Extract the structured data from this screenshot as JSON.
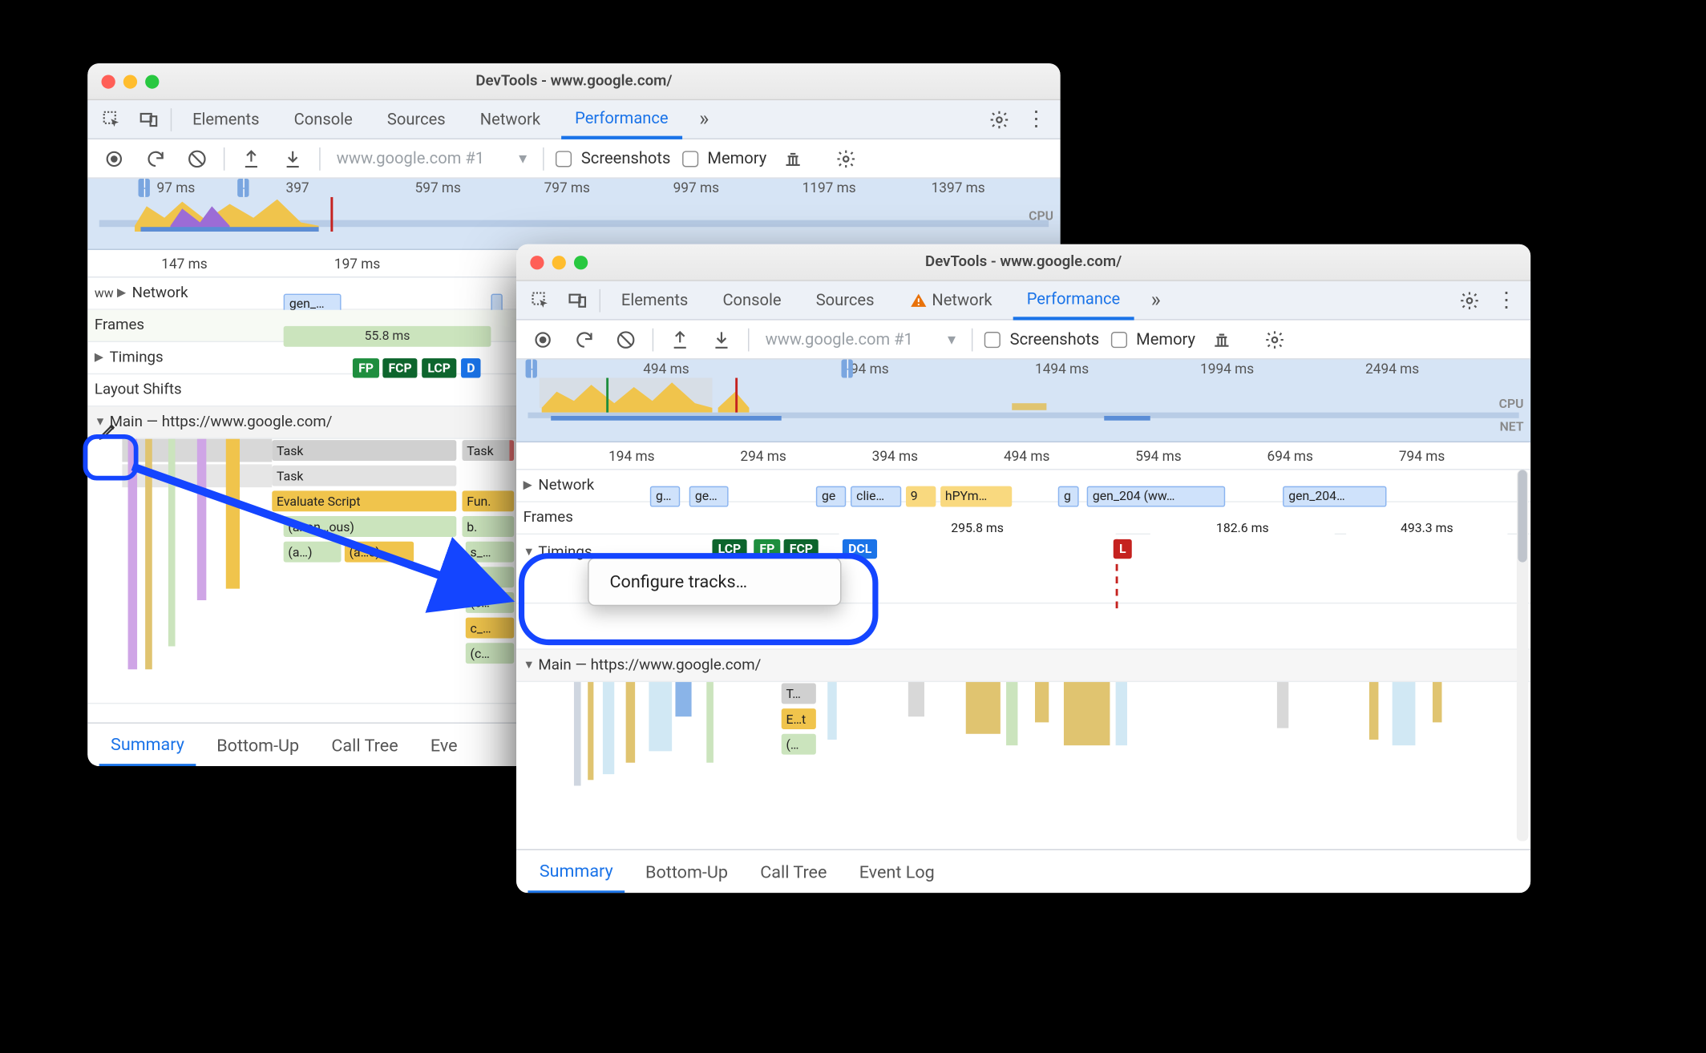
{
  "windowA": {
    "title": "DevTools - www.google.com/",
    "tabs": [
      "Elements",
      "Console",
      "Sources",
      "Network",
      "Performance"
    ],
    "activeTabIndex": 4,
    "dropdown": "www.google.com #1",
    "checkScreenshots": "Screenshots",
    "checkMemory": "Memory",
    "overviewTicks": [
      "97 ms",
      "397",
      "597 ms",
      "797 ms",
      "997 ms",
      "1197 ms",
      "1397 ms"
    ],
    "cpuLabel": "CPU",
    "ruler2": [
      "147 ms",
      "197 ms"
    ],
    "tracks": {
      "networkLabel": "Network",
      "networkPrefix": "ww",
      "networkChip": "gen_…",
      "framesLabel": "Frames",
      "framesValue": "55.8 ms",
      "timingsLabel": "Timings",
      "timingBadges": [
        "FP",
        "FCP",
        "LCP",
        "D"
      ],
      "layoutShiftsLabel": "Layout Shifts",
      "mainLabel": "Main — https://www.google.com/",
      "taskA": "Task",
      "taskB": "Task",
      "taskC": "Task",
      "evalScript": "Evaluate Script",
      "fun": "Fun.",
      "anon": "(anon…ous)",
      "b": "b.",
      "a1": "(a…)",
      "a2": "(a…s)",
      "s": "s_…",
      "dots": "._…",
      "c": "(c…",
      "cdot": "c_…",
      "cparen": "(c…"
    },
    "bottomTabs": [
      "Summary",
      "Bottom-Up",
      "Call Tree",
      "Eve"
    ],
    "activeBottomIndex": 0
  },
  "windowB": {
    "title": "DevTools - www.google.com/",
    "tabs": [
      "Elements",
      "Console",
      "Sources",
      "Network",
      "Performance"
    ],
    "networkWarning": true,
    "activeTabIndex": 4,
    "dropdown": "www.google.com #1",
    "checkScreenshots": "Screenshots",
    "checkMemory": "Memory",
    "overviewTicks": [
      "494 ms",
      "94 ms",
      "1494 ms",
      "1994 ms",
      "2494 ms"
    ],
    "cpuLabel": "CPU",
    "netLabel": "NET",
    "ruler2": [
      "194 ms",
      "294 ms",
      "394 ms",
      "494 ms",
      "594 ms",
      "694 ms",
      "794 ms"
    ],
    "tracks": {
      "networkLabel": "Network",
      "networkChips": [
        "g…",
        "ge…",
        "ge",
        "clie…",
        "9",
        "hPYm…",
        "g",
        "gen_204 (ww…",
        "gen_204…"
      ],
      "framesLabel": "Frames",
      "framesValues": [
        "295.8 ms",
        "182.6 ms",
        "493.3 ms"
      ],
      "timingsLabel": "Timings",
      "timingBadges": [
        "LCP",
        "FP",
        "FCP",
        "DCL"
      ],
      "timingL": "L",
      "mainLabel": "Main — https://www.google.com/",
      "t": "T…",
      "e": "E…t",
      "paren": "(…"
    },
    "contextMenuItem": "Configure tracks…",
    "bottomTabs": [
      "Summary",
      "Bottom-Up",
      "Call Tree",
      "Event Log"
    ],
    "activeBottomIndex": 0
  }
}
